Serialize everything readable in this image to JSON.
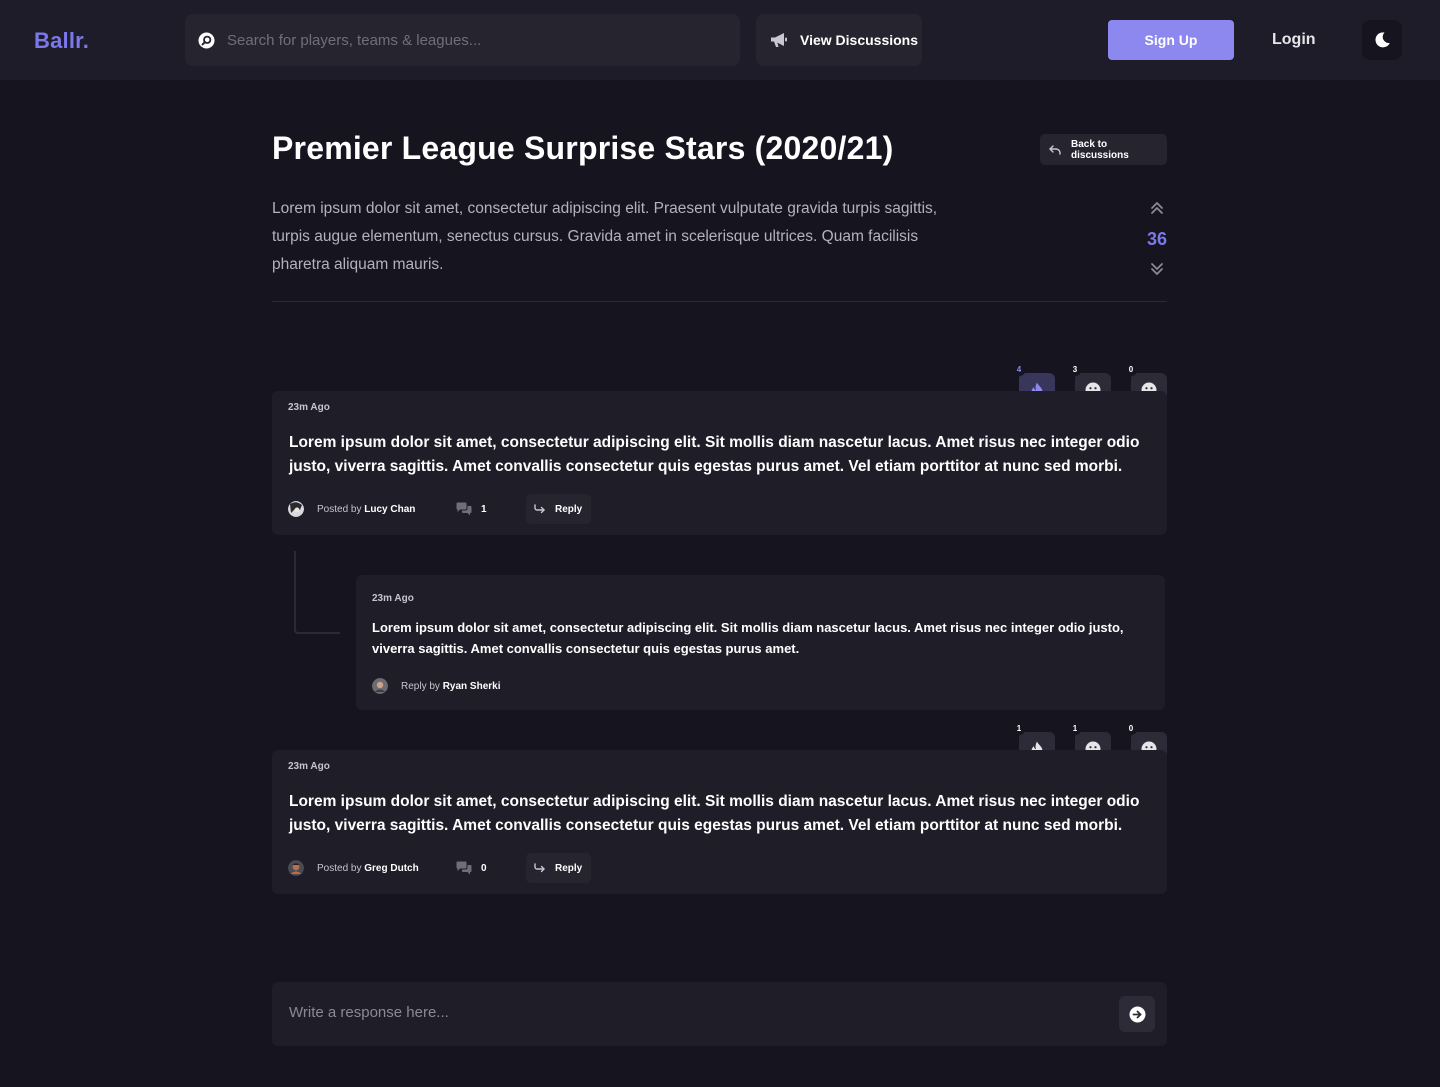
{
  "header": {
    "logo": "Ballr.",
    "search_placeholder": "Search for players, teams & leagues...",
    "view_discussions": "View Discussions",
    "signup": "Sign Up",
    "login": "Login",
    "theme_icon": "moon-icon"
  },
  "discussion": {
    "title": "Premier League Surprise Stars (2020/21)",
    "back_label": "Back to discussions",
    "description": "Lorem ipsum dolor sit amet, consectetur adipiscing elit. Praesent vulputate gravida turpis sagittis, turpis augue elementum, senectus cursus. Gravida amet in scelerisque ultrices. Quam facilisis pharetra aliquam mauris.",
    "votes": "36"
  },
  "comments": [
    {
      "time": "23m Ago",
      "body": "Lorem ipsum dolor sit amet, consectetur adipiscing elit. Sit mollis diam nascetur lacus. Amet risus nec integer odio justo, viverra sagittis. Amet convallis consectetur quis egestas purus amet. Vel etiam porttitor at nunc sed morbi.",
      "posted_prefix": "Posted by",
      "author": "Lucy Chan",
      "comment_count": "1",
      "reply_label": "Reply",
      "reactions": {
        "fire": "4",
        "smile": "3",
        "frown": "0"
      }
    },
    {
      "time": "23m Ago",
      "body": "Lorem ipsum dolor sit amet, consectetur adipiscing elit. Sit mollis diam nascetur lacus. Amet risus nec integer odio justo, viverra sagittis. Amet convallis consectetur quis egestas purus amet. Vel etiam porttitor at nunc sed morbi.",
      "posted_prefix": "Posted by",
      "author": "Greg Dutch",
      "comment_count": "0",
      "reply_label": "Reply",
      "reactions": {
        "fire": "1",
        "smile": "1",
        "frown": "0"
      }
    }
  ],
  "reply": {
    "time": "23m Ago",
    "body": "Lorem ipsum dolor sit amet, consectetur adipiscing elit. Sit mollis diam nascetur lacus. Amet risus nec integer odio justo, viverra sagittis. Amet convallis consectetur quis egestas purus amet.",
    "posted_prefix": "Reply by",
    "author": "Ryan Sherki"
  },
  "response": {
    "placeholder": "Write a response here..."
  },
  "colors": {
    "background": "#16151f",
    "surface": "#1e1d28",
    "accent": "#7b78ea",
    "button_primary": "#8c88f0"
  }
}
